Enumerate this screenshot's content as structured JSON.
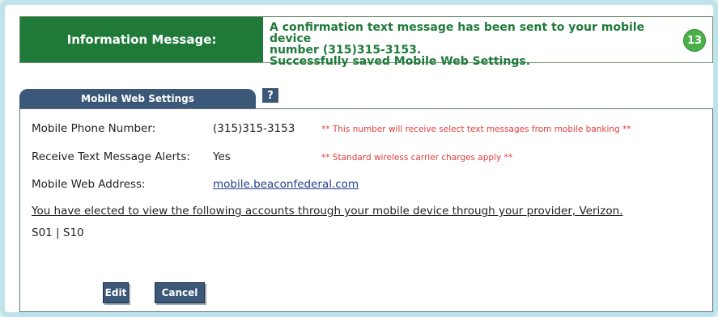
{
  "info": {
    "label": "Information Message:",
    "line1": "A confirmation text message has been sent to your mobile device",
    "line2": "number (315)315-3153.",
    "line3": "Successfully saved Mobile Web Settings.",
    "badge": "13"
  },
  "tab": {
    "title": "Mobile Web Settings",
    "help": "?"
  },
  "settings": {
    "phone_label": "Mobile Phone Number:",
    "phone_value": "(315)315-3153",
    "phone_note": "** This number will receive select text messages from mobile banking **",
    "alerts_label": "Receive Text Message Alerts:",
    "alerts_value": "Yes",
    "alerts_note": "** Standard wireless carrier charges apply **",
    "web_label": "Mobile Web Address:",
    "web_value": "mobile.beaconfederal.com",
    "elected_text": "You have elected to view the following accounts through your mobile device through your provider, Verizon.",
    "accounts": "S01 | S10"
  },
  "buttons": {
    "edit": "Edit",
    "cancel": "Cancel"
  },
  "colors": {
    "info_green": "#1f7a3a",
    "tab_blue": "#3b5878",
    "note_red": "#e53b3b",
    "link_blue": "#24408e"
  }
}
